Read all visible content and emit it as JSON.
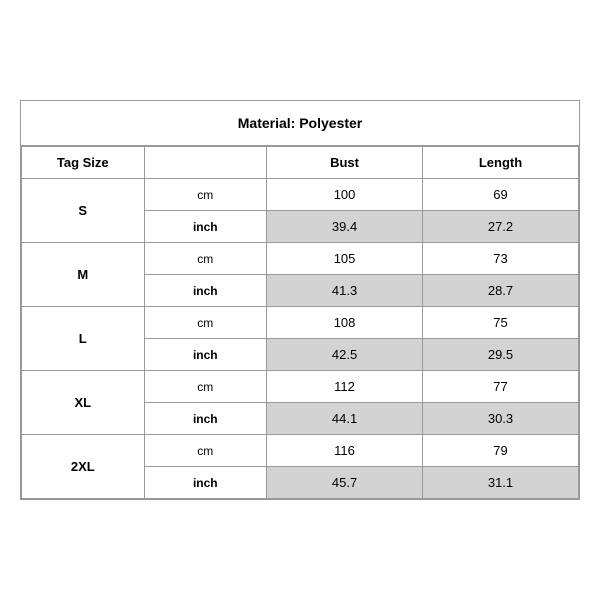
{
  "title": "Material: Polyester",
  "headers": {
    "tag_size": "Tag Size",
    "bust": "Bust",
    "length": "Length"
  },
  "sizes": [
    {
      "tag": "S",
      "rows": [
        {
          "unit": "cm",
          "bust": "100",
          "length": "69",
          "shaded": false
        },
        {
          "unit": "inch",
          "bust": "39.4",
          "length": "27.2",
          "shaded": true
        }
      ]
    },
    {
      "tag": "M",
      "rows": [
        {
          "unit": "cm",
          "bust": "105",
          "length": "73",
          "shaded": false
        },
        {
          "unit": "inch",
          "bust": "41.3",
          "length": "28.7",
          "shaded": true
        }
      ]
    },
    {
      "tag": "L",
      "rows": [
        {
          "unit": "cm",
          "bust": "108",
          "length": "75",
          "shaded": false
        },
        {
          "unit": "inch",
          "bust": "42.5",
          "length": "29.5",
          "shaded": true
        }
      ]
    },
    {
      "tag": "XL",
      "rows": [
        {
          "unit": "cm",
          "bust": "112",
          "length": "77",
          "shaded": false
        },
        {
          "unit": "inch",
          "bust": "44.1",
          "length": "30.3",
          "shaded": true
        }
      ]
    },
    {
      "tag": "2XL",
      "rows": [
        {
          "unit": "cm",
          "bust": "116",
          "length": "79",
          "shaded": false
        },
        {
          "unit": "inch",
          "bust": "45.7",
          "length": "31.1",
          "shaded": true
        }
      ]
    }
  ]
}
